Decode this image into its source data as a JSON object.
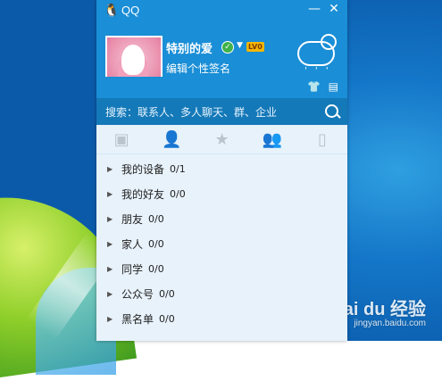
{
  "window": {
    "title": "QQ",
    "minimize_label": "—",
    "close_label": "✕"
  },
  "profile": {
    "nickname": "特别的爱",
    "level_badge": "LV0",
    "signature": "编辑个性签名"
  },
  "search": {
    "placeholder": "搜索：联系人、多人聊天、群、企业"
  },
  "tabs": [
    {
      "icon": "chat-icon",
      "glyph": "▣"
    },
    {
      "icon": "contacts-icon",
      "glyph": "👤"
    },
    {
      "icon": "favorites-icon",
      "glyph": "★"
    },
    {
      "icon": "groups-icon",
      "glyph": "👥"
    },
    {
      "icon": "phone-icon",
      "glyph": "▯"
    }
  ],
  "groups": [
    {
      "name": "我的设备",
      "count": "0/1"
    },
    {
      "name": "我的好友",
      "count": "0/0"
    },
    {
      "name": "朋友",
      "count": "0/0"
    },
    {
      "name": "家人",
      "count": "0/0"
    },
    {
      "name": "同学",
      "count": "0/0"
    },
    {
      "name": "公众号",
      "count": "0/0"
    },
    {
      "name": "黑名单",
      "count": "0/0"
    }
  ],
  "watermark": {
    "text": "Bai du 经验",
    "sub": "jingyan.baidu.com"
  },
  "colors": {
    "accent": "#1a8ed6",
    "search_bar": "#1479b8",
    "list_bg": "#e8f2fb"
  }
}
